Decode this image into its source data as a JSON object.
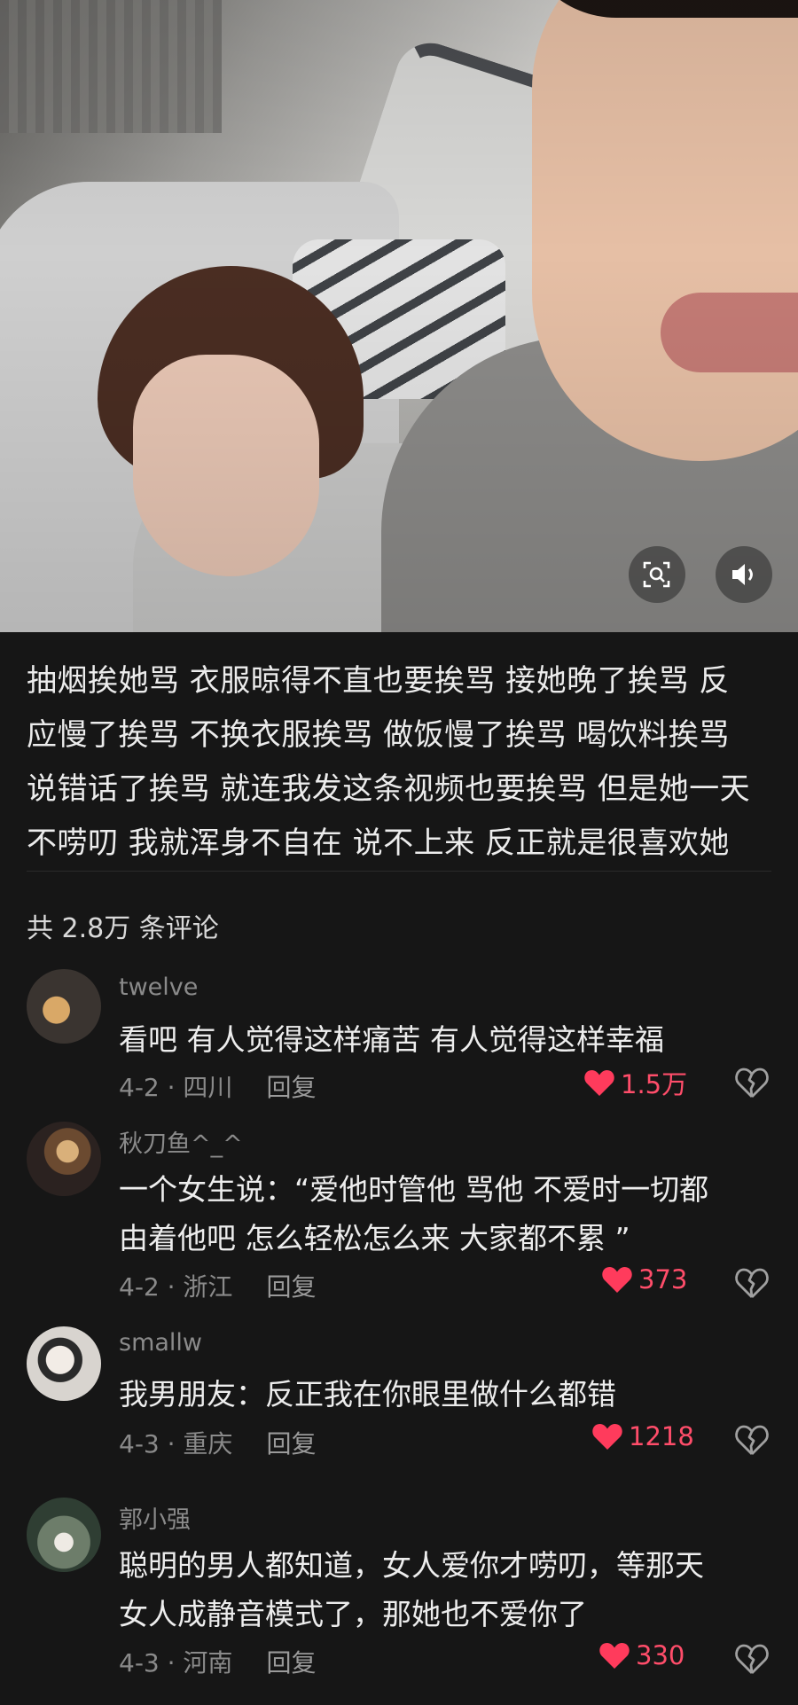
{
  "video": {
    "scan_icon": "scan-search-icon",
    "volume_icon": "volume-icon"
  },
  "caption": {
    "lines": [
      "抽烟挨她骂 衣服晾得不直也要挨骂 接她晚了挨骂 反",
      "应慢了挨骂 不换衣服挨骂 做饭慢了挨骂 喝饮料挨骂",
      "说错话了挨骂 就连我发这条视频也要挨骂 但是她一天",
      "不唠叨 我就浑身不自在 说不上来 反正就是很喜欢她"
    ]
  },
  "comments_header": {
    "count_text": "共 2.8万 条评论"
  },
  "comments": [
    {
      "name": "twelve",
      "lines": [
        "看吧  有人觉得这样痛苦  有人觉得这样幸福"
      ],
      "meta": "4-2 · 四川",
      "reply_label": "回复",
      "likes": "1.5万",
      "like_color": "#ff3b5c"
    },
    {
      "name": "秋刀鱼^_^",
      "lines": [
        "一个女生说：“爱他时管他 骂他 不爱时一切都",
        "由着他吧 怎么轻松怎么来 大家都不累 ”"
      ],
      "meta": "4-2 · 浙江",
      "reply_label": "回复",
      "likes": "373",
      "like_color": "#ff3b5c"
    },
    {
      "name": "smallw",
      "lines": [
        "我男朋友：反正我在你眼里做什么都错"
      ],
      "meta": "4-3 · 重庆",
      "reply_label": "回复",
      "likes": "1218",
      "like_color": "#ff3b5c"
    },
    {
      "name": "郭小强",
      "lines": [
        "聪明的男人都知道，女人爱你才唠叨，等那天",
        "女人成静音模式了，那她也不爱你了"
      ],
      "meta": "4-3 · 河南",
      "reply_label": "回复",
      "likes": "330",
      "like_color": "#ff3b5c"
    }
  ]
}
